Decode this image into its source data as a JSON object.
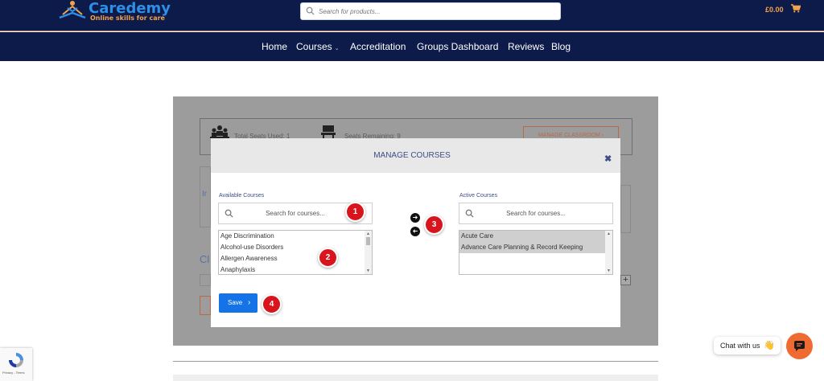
{
  "header": {
    "logo_name": "Caredemy",
    "logo_tagline": "Online skills for care",
    "search_placeholder": "Search for products...",
    "cart_total": "£0.00"
  },
  "nav": {
    "items": [
      {
        "label": "Home"
      },
      {
        "label": "Courses"
      },
      {
        "label": "Accreditation"
      },
      {
        "label": "Groups Dashboard"
      },
      {
        "label": "Reviews"
      },
      {
        "label": "Blog"
      }
    ]
  },
  "background": {
    "total_seats_used": "Total Seats Used: 1",
    "seats_remaining": "Seats Remaining: 9",
    "manage_classroom": "MANAGE CLASSROOM",
    "frag_ir": "Ir",
    "frag_cl": "Cl"
  },
  "modal": {
    "title": "MANAGE COURSES",
    "close": "✖",
    "available_label": "Available Courses",
    "active_label": "Active Courses",
    "search_placeholder": "Search for courses...",
    "available_courses": [
      "Age Discrimination",
      "Alcohol-use Disorders",
      "Allergen Awareness",
      "Anaphylaxis"
    ],
    "active_courses": [
      "Acute Care",
      "Advance Care Planning & Record Keeping"
    ],
    "save_label": "Save"
  },
  "badges": [
    "1",
    "2",
    "3",
    "4"
  ],
  "chat": {
    "label": "Chat with us",
    "wave": "👋"
  },
  "recaptcha": {
    "text": "Privacy - Terms"
  },
  "colors": {
    "navy": "#0d1b4a",
    "brand_blue": "#2f8fe6",
    "orange": "#f3a14a",
    "save_blue": "#1473e6",
    "badge_red": "#d8141d",
    "chat_orange": "#f06b32"
  }
}
